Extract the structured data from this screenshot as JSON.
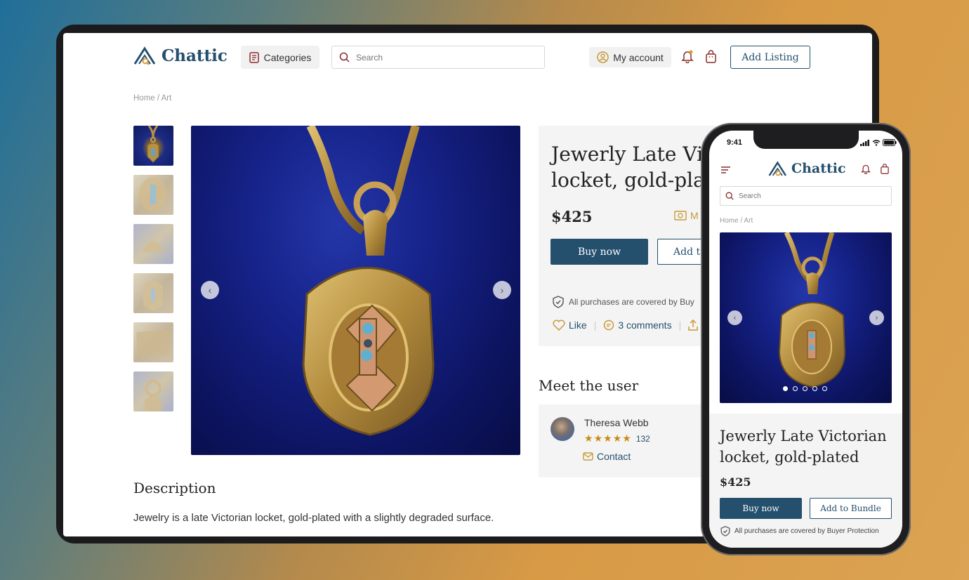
{
  "desktop": {
    "brand": "Chattic",
    "nav": {
      "categories_label": "Categories",
      "search_placeholder": "Search",
      "account_label": "My account",
      "add_listing_label": "Add Listing"
    },
    "breadcrumb": "Home / Art",
    "product": {
      "title": "Jewerly Late Victo locket, gold-plate",
      "title_line1": "Jewerly Late Victo",
      "title_line2": "locket, gold-plate",
      "price": "$425",
      "make_offer_partial": "M",
      "buy_label": "Buy now",
      "add_partial_label": "Add t",
      "protection_text": "All purchases are covered by Buy",
      "like_label": "Like",
      "comments_label": "3 comments"
    },
    "seller": {
      "section_title": "Meet the user",
      "name": "Theresa Webb",
      "rating_count": "132",
      "contact_label": "Contact"
    },
    "description": {
      "heading": "Description",
      "text": "Jewelry is a late Victorian locket, gold-plated with a slightly degraded surface."
    }
  },
  "mobile": {
    "time": "9:41",
    "brand": "Chattic",
    "search_placeholder": "Search",
    "breadcrumb": "Home / Art",
    "product": {
      "title": "Jewerly Late Victorian locket, gold-plated",
      "price": "$425",
      "buy_label": "Buy now",
      "add_bundle_label": "Add to Bundle",
      "protection_text": "All purchases are covered by Buyer Protection"
    },
    "carousel_dots": 5,
    "carousel_active": 1
  },
  "colors": {
    "primary": "#24506e",
    "accent_gold": "#c89a3a",
    "star": "#c98a12",
    "panel_bg": "#f4f4f4"
  },
  "icons": [
    "categories-icon",
    "search-icon",
    "account-icon",
    "bell-icon",
    "bag-icon",
    "shield-icon",
    "heart-icon",
    "comment-icon",
    "share-icon",
    "money-icon",
    "mail-icon",
    "star-icon",
    "chevron-left-icon",
    "chevron-right-icon",
    "menu-icon"
  ]
}
